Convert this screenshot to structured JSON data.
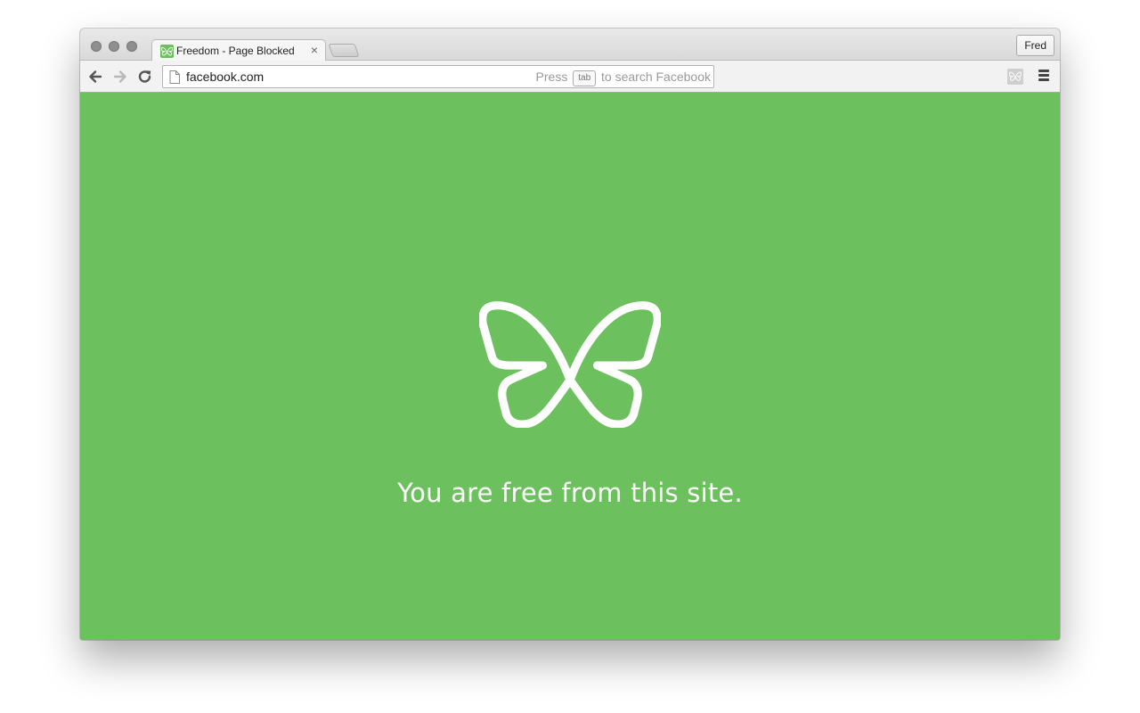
{
  "window": {
    "profile_name": "Fred"
  },
  "tab": {
    "title": "Freedom - Page Blocked",
    "close_glyph": "×",
    "favicon": "butterfly-icon"
  },
  "toolbar": {
    "back_icon": "arrow-left-icon",
    "forward_icon": "arrow-right-icon",
    "reload_icon": "reload-icon",
    "url": "facebook.com",
    "hint_prefix": "Press",
    "hint_key": "tab",
    "hint_suffix": "to search Facebook",
    "extension_icon": "butterfly-icon",
    "menu_icon": "hamburger-menu-icon"
  },
  "content": {
    "message": "You are free from this site.",
    "background_color": "#6cc05d",
    "logo": "butterfly-logo"
  }
}
